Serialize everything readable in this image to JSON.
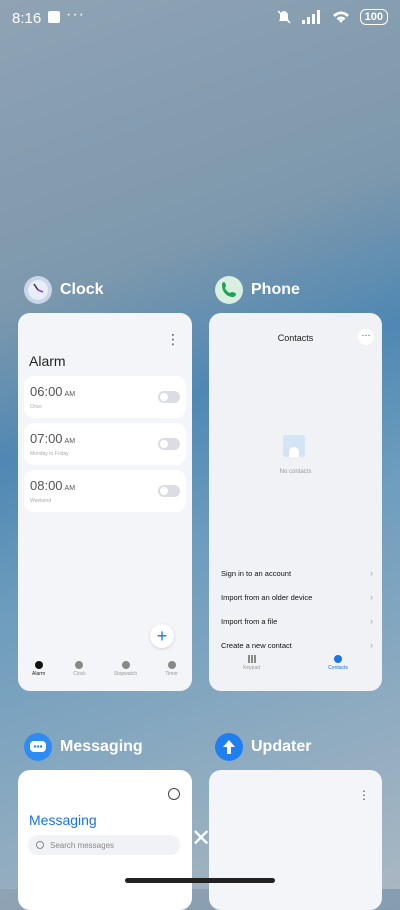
{
  "status": {
    "time": "8:16",
    "dots": "···",
    "battery": "100"
  },
  "apps": {
    "clock": {
      "name": "Clock",
      "screen_title": "Alarm",
      "alarms": [
        {
          "time": "06:00",
          "ampm": "AM",
          "sub": "Once"
        },
        {
          "time": "07:00",
          "ampm": "AM",
          "sub": "Monday to Friday"
        },
        {
          "time": "08:00",
          "ampm": "AM",
          "sub": "Weekend"
        }
      ],
      "add_label": "+",
      "nav": [
        "Alarm",
        "Clock",
        "Stopwatch",
        "Timer"
      ]
    },
    "phone": {
      "name": "Phone",
      "screen_title": "Contacts",
      "empty_text": "No contacts",
      "options": [
        "Sign in to an account",
        "Import from an older device",
        "Import from a file",
        "Create a new contact"
      ],
      "nav": [
        "Keypad",
        "Contacts"
      ]
    },
    "messaging": {
      "name": "Messaging",
      "screen_title": "Messaging",
      "search_placeholder": "Search messages"
    },
    "updater": {
      "name": "Updater"
    }
  },
  "close_label": "✕"
}
